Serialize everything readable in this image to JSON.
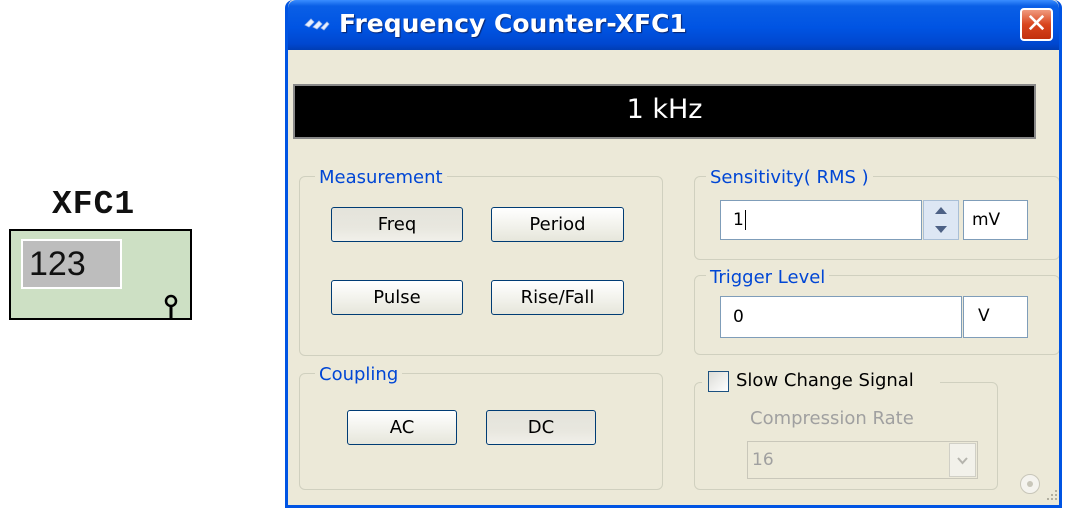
{
  "symbol": {
    "label": "XFC1",
    "display": "123"
  },
  "window": {
    "title": "Frequency Counter-XFC1",
    "close_label": "✕",
    "readout": "1 kHz"
  },
  "measurement": {
    "legend": "Measurement",
    "buttons": {
      "freq": "Freq",
      "period": "Period",
      "pulse": "Pulse",
      "rise_fall": "Rise/Fall"
    },
    "active": "Freq"
  },
  "coupling": {
    "legend": "Coupling",
    "buttons": {
      "ac": "AC",
      "dc": "DC"
    },
    "active": "DC"
  },
  "sensitivity": {
    "legend": "Sensitivity( RMS )",
    "value": "1",
    "unit": "mV"
  },
  "trigger": {
    "legend": "Trigger Level",
    "value": "0",
    "unit": "V"
  },
  "slow_change": {
    "label": "Slow Change Signal",
    "checked": false,
    "compression_label": "Compression Rate",
    "compression_value": "16"
  },
  "colors": {
    "titlebar": "#0054e3",
    "group_legend": "#0046d5",
    "symbol_fill": "#cde0c4"
  }
}
